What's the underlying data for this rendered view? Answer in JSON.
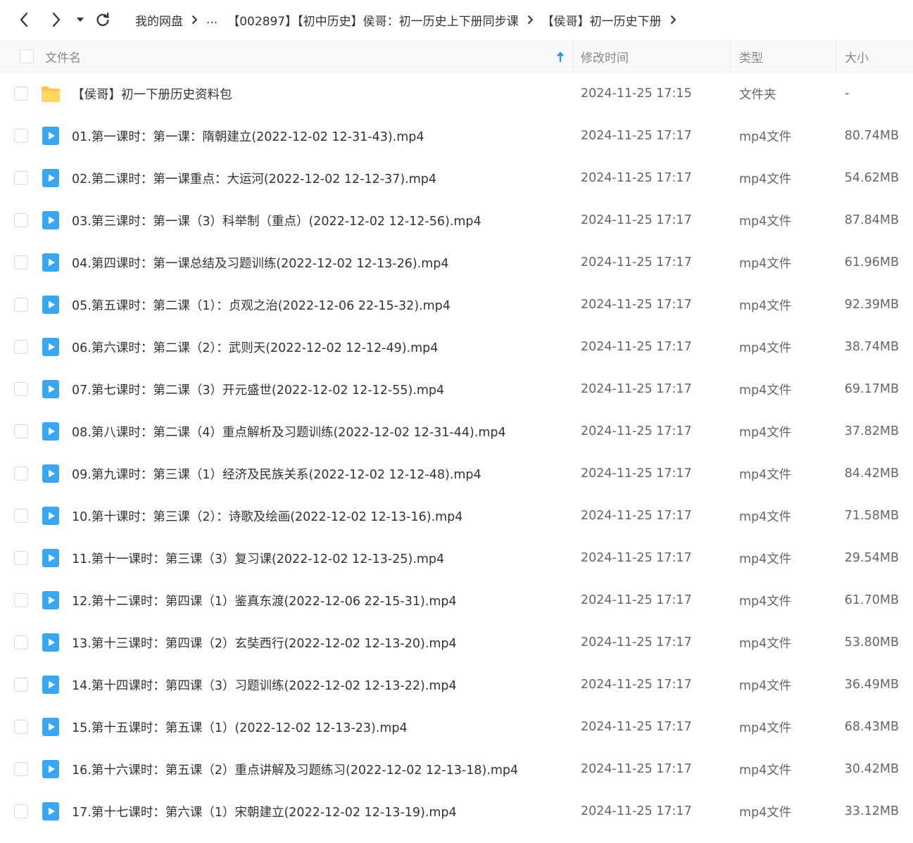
{
  "toolbar": {
    "back_icon": "chevron-left-icon",
    "forward_icon": "chevron-right-icon",
    "history_icon": "caret-down-icon",
    "refresh_icon": "refresh-icon"
  },
  "breadcrumb": {
    "items": [
      "我的网盘",
      "...",
      "【002897】【初中历史】侯哥：初一历史上下册同步课",
      "【侯哥】初一历史下册"
    ]
  },
  "header": {
    "name": "文件名",
    "sort_icon": "arrow-up-icon",
    "modified": "修改时间",
    "type": "类型",
    "size": "大小"
  },
  "files": [
    {
      "kind": "folder",
      "name": "【侯哥】初一下册历史资料包",
      "modified": "2024-11-25 17:15",
      "type": "文件夹",
      "size": "-"
    },
    {
      "kind": "video",
      "name": "01.第一课时：第一课：隋朝建立(2022-12-02 12-31-43).mp4",
      "modified": "2024-11-25 17:17",
      "type": "mp4文件",
      "size": "80.74MB"
    },
    {
      "kind": "video",
      "name": "02.第二课时：第一课重点：大运河(2022-12-02 12-12-37).mp4",
      "modified": "2024-11-25 17:17",
      "type": "mp4文件",
      "size": "54.62MB"
    },
    {
      "kind": "video",
      "name": "03.第三课时：第一课（3）科举制（重点）(2022-12-02 12-12-56).mp4",
      "modified": "2024-11-25 17:17",
      "type": "mp4文件",
      "size": "87.84MB"
    },
    {
      "kind": "video",
      "name": "04.第四课时：第一课总结及习题训练(2022-12-02 12-13-26).mp4",
      "modified": "2024-11-25 17:17",
      "type": "mp4文件",
      "size": "61.96MB"
    },
    {
      "kind": "video",
      "name": "05.第五课时：第二课（1）：贞观之治(2022-12-06 22-15-32).mp4",
      "modified": "2024-11-25 17:17",
      "type": "mp4文件",
      "size": "92.39MB"
    },
    {
      "kind": "video",
      "name": "06.第六课时：第二课（2）：武则天(2022-12-02 12-12-49).mp4",
      "modified": "2024-11-25 17:17",
      "type": "mp4文件",
      "size": "38.74MB"
    },
    {
      "kind": "video",
      "name": "07.第七课时：第二课（3）开元盛世(2022-12-02 12-12-55).mp4",
      "modified": "2024-11-25 17:17",
      "type": "mp4文件",
      "size": "69.17MB"
    },
    {
      "kind": "video",
      "name": "08.第八课时：第二课（4）重点解析及习题训练(2022-12-02 12-31-44).mp4",
      "modified": "2024-11-25 17:17",
      "type": "mp4文件",
      "size": "37.82MB"
    },
    {
      "kind": "video",
      "name": "09.第九课时：第三课（1）经济及民族关系(2022-12-02 12-12-48).mp4",
      "modified": "2024-11-25 17:17",
      "type": "mp4文件",
      "size": "84.42MB"
    },
    {
      "kind": "video",
      "name": "10.第十课时：第三课（2）：诗歌及绘画(2022-12-02 12-13-16).mp4",
      "modified": "2024-11-25 17:17",
      "type": "mp4文件",
      "size": "71.58MB"
    },
    {
      "kind": "video",
      "name": "11.第十一课时：第三课（3）复习课(2022-12-02 12-13-25).mp4",
      "modified": "2024-11-25 17:17",
      "type": "mp4文件",
      "size": "29.54MB"
    },
    {
      "kind": "video",
      "name": "12.第十二课时：第四课（1）鉴真东渡(2022-12-06 22-15-31).mp4",
      "modified": "2024-11-25 17:17",
      "type": "mp4文件",
      "size": "61.70MB"
    },
    {
      "kind": "video",
      "name": "13.第十三课时：第四课（2）玄奘西行(2022-12-02 12-13-20).mp4",
      "modified": "2024-11-25 17:17",
      "type": "mp4文件",
      "size": "53.80MB"
    },
    {
      "kind": "video",
      "name": "14.第十四课时：第四课（3）习题训练(2022-12-02 12-13-22).mp4",
      "modified": "2024-11-25 17:17",
      "type": "mp4文件",
      "size": "36.49MB"
    },
    {
      "kind": "video",
      "name": "15.第十五课时：第五课（1）(2022-12-02 12-13-23).mp4",
      "modified": "2024-11-25 17:17",
      "type": "mp4文件",
      "size": "68.43MB"
    },
    {
      "kind": "video",
      "name": "16.第十六课时：第五课（2）重点讲解及习题练习(2022-12-02 12-13-18).mp4",
      "modified": "2024-11-25 17:17",
      "type": "mp4文件",
      "size": "30.42MB"
    },
    {
      "kind": "video",
      "name": "17.第十七课时：第六课（1）宋朝建立(2022-12-02 12-13-19).mp4",
      "modified": "2024-11-25 17:17",
      "type": "mp4文件",
      "size": "33.12MB"
    }
  ],
  "colors": {
    "accent": "#1e90ff",
    "folder": "#ffc53d",
    "video": "#3aa6f2"
  }
}
